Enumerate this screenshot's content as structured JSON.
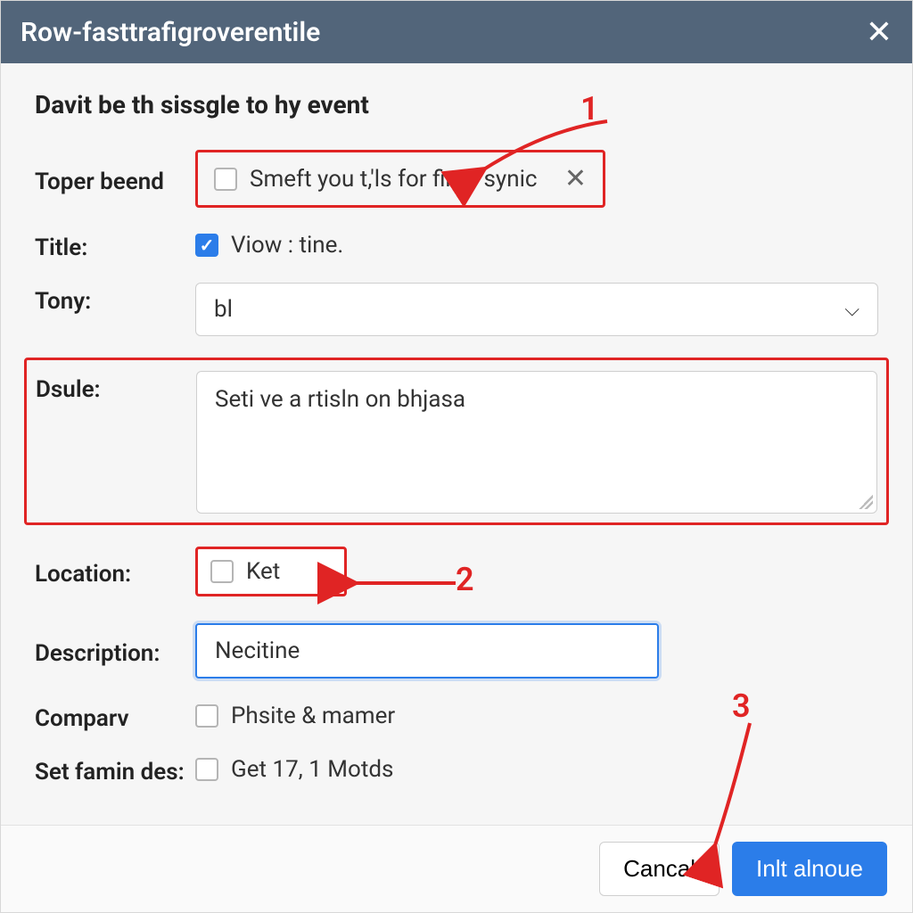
{
  "titlebar": {
    "title": "Row-fasttrafigroverentile"
  },
  "heading": "Davit be th sissgle to hy event",
  "labels": {
    "toper": "Toper beend",
    "title": "Title:",
    "tony": "Tony:",
    "dsule": "Dsule:",
    "location": "Location:",
    "description": "Description:",
    "company": "Comparv",
    "setfamin": "Set famin des:"
  },
  "fields": {
    "toper_text": "Smeft you t,'ls for fime synic",
    "title_text": "Viow : tine.",
    "tony_value": "bl",
    "dsule_value": "Seti ve a rtisln on bhjasa",
    "location_value": "Ket",
    "description_value": "Necitine",
    "company_text": "Phsite & mamer",
    "setfamin_text": "Get 17, 1 Motds"
  },
  "buttons": {
    "cancel": "Cancal",
    "submit": "Inlt alnoue"
  },
  "annotations": {
    "n1": "1",
    "n2": "2",
    "n3": "3"
  }
}
